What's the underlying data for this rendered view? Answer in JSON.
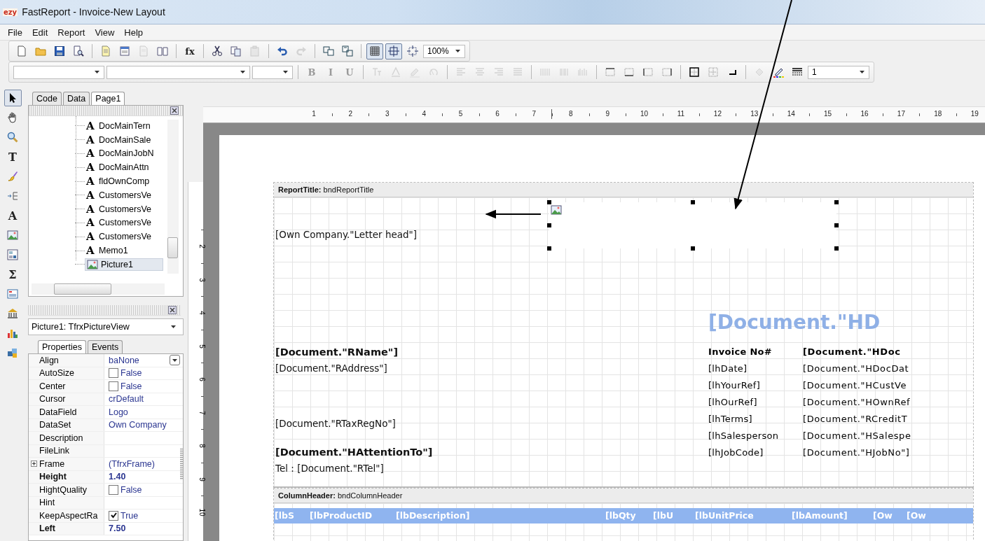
{
  "window": {
    "logo": "ezy",
    "title": "FastReport - Invoice-New Layout"
  },
  "menu": [
    "File",
    "Edit",
    "Report",
    "View",
    "Help"
  ],
  "toolbars": [
    {
      "groups": [
        [
          {
            "kind": "icon",
            "pressed": false,
            "disabled": false
          },
          {
            "kind": "icon",
            "pressed": false,
            "disabled": false
          },
          {
            "kind": "icon",
            "pressed": false,
            "disabled": false
          },
          {
            "kind": "icon",
            "pressed": false,
            "disabled": false
          }
        ],
        [
          {
            "kind": "icon",
            "pressed": false,
            "disabled": false
          },
          {
            "kind": "icon",
            "pressed": false,
            "disabled": false
          },
          {
            "kind": "icon",
            "pressed": false,
            "disabled": true
          },
          {
            "kind": "icon",
            "pressed": false,
            "disabled": false
          }
        ],
        [
          {
            "kind": "glyph",
            "glyph": "fx",
            "pressed": false,
            "disabled": false
          }
        ],
        [
          {
            "kind": "icon",
            "pressed": false,
            "disabled": false
          },
          {
            "kind": "icon",
            "pressed": false,
            "disabled": false
          },
          {
            "kind": "icon",
            "pressed": false,
            "disabled": true
          }
        ],
        [
          {
            "kind": "icon",
            "pressed": false,
            "disabled": false
          },
          {
            "kind": "icon",
            "pressed": false,
            "disabled": true
          }
        ],
        [
          {
            "kind": "icon",
            "pressed": false,
            "disabled": false
          },
          {
            "kind": "icon",
            "pressed": false,
            "disabled": false
          }
        ],
        [
          {
            "kind": "icon",
            "pressed": true,
            "disabled": false
          },
          {
            "kind": "icon",
            "pressed": true,
            "disabled": false
          },
          {
            "kind": "icon",
            "pressed": false,
            "disabled": false
          },
          {
            "kind": "combo",
            "value": "100%",
            "disabled": false
          }
        ]
      ]
    },
    {
      "groups": [
        [
          {
            "kind": "combo",
            "disabled": false
          },
          {
            "kind": "combo",
            "disabled": false
          },
          {
            "kind": "combo",
            "disabled": false
          }
        ],
        [
          {
            "kind": "glyph",
            "glyph": "B",
            "pressed": false,
            "disabled": true
          },
          {
            "kind": "glyph",
            "glyph": "I",
            "pressed": false,
            "disabled": true
          },
          {
            "kind": "glyph",
            "glyph": "U",
            "pressed": false,
            "disabled": true
          }
        ],
        [
          {
            "kind": "icon",
            "pressed": false,
            "disabled": true
          },
          {
            "kind": "icon",
            "pressed": false,
            "disabled": true
          },
          {
            "kind": "icon",
            "pressed": false,
            "disabled": true
          },
          {
            "kind": "icon",
            "pressed": false,
            "disabled": true
          }
        ],
        [
          {
            "kind": "icon",
            "pressed": false,
            "disabled": true
          },
          {
            "kind": "icon",
            "pressed": false,
            "disabled": true
          },
          {
            "kind": "icon",
            "pressed": false,
            "disabled": true
          },
          {
            "kind": "icon",
            "pressed": false,
            "disabled": true
          }
        ],
        [
          {
            "kind": "icon",
            "pressed": false,
            "disabled": true
          },
          {
            "kind": "icon",
            "pressed": false,
            "disabled": true
          },
          {
            "kind": "icon",
            "pressed": false,
            "disabled": true
          }
        ],
        [
          {
            "kind": "icon",
            "pressed": false,
            "disabled": false
          },
          {
            "kind": "icon",
            "pressed": false,
            "disabled": false
          },
          {
            "kind": "icon",
            "pressed": false,
            "disabled": false
          },
          {
            "kind": "icon",
            "pressed": false,
            "disabled": false
          }
        ],
        [
          {
            "kind": "icon",
            "pressed": false,
            "disabled": false
          },
          {
            "kind": "icon",
            "pressed": false,
            "disabled": false
          },
          {
            "kind": "icon",
            "pressed": false,
            "disabled": false
          }
        ],
        [
          {
            "kind": "icon",
            "pressed": false,
            "disabled": true
          },
          {
            "kind": "icon",
            "pressed": false,
            "disabled": false
          },
          {
            "kind": "icon",
            "pressed": false,
            "disabled": false
          },
          {
            "kind": "combo",
            "value": "1",
            "disabled": false
          }
        ]
      ]
    }
  ],
  "palette": [
    {
      "pressed": true
    },
    {
      "pressed": false
    },
    {
      "pressed": false
    },
    {
      "glyph": "T",
      "pressed": false
    },
    {
      "pressed": false
    },
    {
      "pressed": false
    },
    {
      "glyph": "A",
      "pressed": false
    },
    {
      "pressed": false
    },
    {
      "pressed": false
    },
    {
      "glyph": "Σ",
      "pressed": false
    },
    {
      "pressed": false
    },
    {
      "pressed": false
    },
    {
      "pressed": false
    },
    {
      "pressed": false
    }
  ],
  "page_tabs": [
    {
      "label": "Code",
      "selected": false
    },
    {
      "label": "Data",
      "selected": false
    },
    {
      "label": "Page1",
      "selected": true
    }
  ],
  "tree": {
    "items": [
      {
        "kind": "text",
        "glyph": "A",
        "label": "DocMainTern",
        "selected": false
      },
      {
        "kind": "text",
        "glyph": "A",
        "label": "DocMainSale",
        "selected": false
      },
      {
        "kind": "text",
        "glyph": "A",
        "label": "DocMainJobN",
        "selected": false
      },
      {
        "kind": "text",
        "glyph": "A",
        "label": "DocMainAttn",
        "selected": false
      },
      {
        "kind": "text",
        "glyph": "A",
        "label": "fldOwnComp",
        "selected": false
      },
      {
        "kind": "text",
        "glyph": "A",
        "label": "CustomersVe",
        "selected": false
      },
      {
        "kind": "text",
        "glyph": "A",
        "label": "CustomersVe",
        "selected": false
      },
      {
        "kind": "text",
        "glyph": "A",
        "label": "CustomersVe",
        "selected": false
      },
      {
        "kind": "text",
        "glyph": "A",
        "label": "CustomersVe",
        "selected": false
      },
      {
        "kind": "text",
        "glyph": "A",
        "label": "Memo1",
        "selected": false
      },
      {
        "kind": "picture",
        "label": "Picture1",
        "selected": true
      }
    ]
  },
  "object_selector": {
    "value": "Picture1: TfrxPictureView"
  },
  "inspector_tabs": [
    {
      "label": "Properties",
      "selected": true
    },
    {
      "label": "Events",
      "selected": false
    }
  ],
  "properties": [
    {
      "name": "Align",
      "value": "baNone",
      "kind": "dropdown",
      "bold": false
    },
    {
      "name": "AutoSize",
      "value": "False",
      "kind": "checkbox",
      "checked": false,
      "bold": false
    },
    {
      "name": "Center",
      "value": "False",
      "kind": "checkbox",
      "checked": false,
      "bold": false
    },
    {
      "name": "Cursor",
      "value": "crDefault",
      "kind": "text",
      "bold": false
    },
    {
      "name": "DataField",
      "value": "Logo",
      "kind": "text",
      "bold": false
    },
    {
      "name": "DataSet",
      "value": "Own Company",
      "kind": "text",
      "bold": false
    },
    {
      "name": "Description",
      "kind": "text",
      "bold": false
    },
    {
      "name": "FileLink",
      "kind": "text",
      "bold": false
    },
    {
      "name": "Frame",
      "value": "(TfrxFrame)",
      "kind": "group",
      "expanded": false,
      "bold": false
    },
    {
      "name": "Height",
      "value": "1.40",
      "kind": "text",
      "bold": true
    },
    {
      "name": "HightQuality",
      "value": "False",
      "kind": "checkbox",
      "checked": false,
      "bold": false
    },
    {
      "name": "Hint",
      "kind": "text",
      "bold": false
    },
    {
      "name": "KeepAspectRa",
      "value": "True",
      "kind": "checkbox",
      "checked": true,
      "bold": false
    },
    {
      "name": "Left",
      "value": "7.50",
      "kind": "text",
      "bold": true
    }
  ],
  "rulers": {
    "horizontal": [
      "1",
      "2",
      "3",
      "4",
      "5",
      "6",
      "7",
      "8",
      "9",
      "10",
      "11",
      "12",
      "13",
      "14",
      "15",
      "16",
      "17",
      "18",
      "19"
    ],
    "vertical": [
      "2",
      "3",
      "4",
      "5",
      "6",
      "7",
      "8",
      "9",
      "10"
    ]
  },
  "report": {
    "bands": [
      {
        "kind": "title",
        "header": "**ReportTitle:** bndReportTitle",
        "picture": {
          "selected": true
        },
        "letterhead": "[Own Company.\"Letter head\"]",
        "doc_title": "[Document.\"HD",
        "memos": [
          {
            "text": "[Document.\"RName\"]",
            "bold": true
          },
          {
            "text": "[Document.\"RAddress\"]",
            "bold": false
          },
          {
            "text": "[Document.\"RTaxRegNo\"]",
            "bold": false
          },
          {
            "text": "[Document.\"HAttentionTo\"]",
            "bold": true
          },
          {
            "text": "Tel : [Document.\"RTel\"]",
            "bold": false
          }
        ],
        "info": [
          {
            "label": "Invoice No#",
            "value": "[Document.\"HDoc",
            "bold": true
          },
          {
            "label": "[lhDate]",
            "value": "[Document.\"HDocDat",
            "bold": false
          },
          {
            "label": "[lhYourRef]",
            "value": "[Document.\"HCustVe",
            "bold": false
          },
          {
            "label": "[lhOurRef]",
            "value": "[Document.\"HOwnRef",
            "bold": false
          },
          {
            "label": "[lhTerms]",
            "value": "[Document.\"RCreditT",
            "bold": false
          },
          {
            "label": "[lhSalesperson",
            "value": "[Document.\"HSalespe",
            "bold": false
          },
          {
            "label": "[lhJobCode]",
            "value": "[Document.\"HJobNo\"]",
            "bold": false
          }
        ]
      },
      {
        "kind": "column_header",
        "header": "**ColumnHeader:** bndColumnHeader",
        "cells": [
          "[lbS",
          "[lbProductID",
          "[lbDescription]",
          "[lbQty",
          "[lbU",
          "[lbUnitPrice",
          "[lbAmount]",
          "[Ow",
          "[Ow"
        ]
      }
    ]
  }
}
